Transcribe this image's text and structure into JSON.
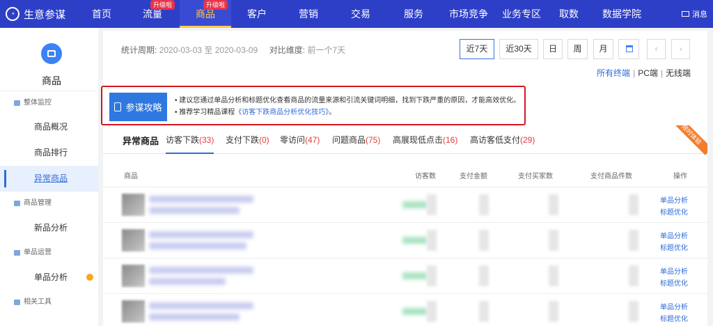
{
  "topnav": {
    "brand": "生意参谋",
    "items": [
      {
        "label": "首页",
        "badge": ""
      },
      {
        "label": "流量",
        "badge": "升级啦"
      },
      {
        "label": "商品",
        "badge": "升级啦"
      },
      {
        "label": "客户",
        "badge": ""
      },
      {
        "label": "营销",
        "badge": ""
      },
      {
        "label": "交易",
        "badge": ""
      },
      {
        "label": "服务",
        "badge": ""
      },
      {
        "label": "市场竞争",
        "badge": ""
      },
      {
        "label": "业务专区",
        "badge": ""
      },
      {
        "label": "取数",
        "badge": ""
      },
      {
        "label": "数据学院",
        "badge": ""
      }
    ],
    "active_index": 2,
    "message": "消息"
  },
  "sidebar": {
    "title": "商品",
    "groups": [
      {
        "label": "整体监控",
        "items": [
          "商品概况",
          "商品排行",
          "异常商品"
        ]
      },
      {
        "label": "商品管理",
        "items": [
          "新品分析"
        ]
      },
      {
        "label": "单品运营",
        "items": [
          "单品分析"
        ]
      },
      {
        "label": "相关工具",
        "items": []
      }
    ],
    "active_item": "异常商品"
  },
  "filter": {
    "period_label": "统计周期:",
    "period_value": "2020-03-03 至 2020-03-09",
    "compare_label": "对比维度:",
    "compare_value": "前一个7天",
    "buttons": [
      "近7天",
      "近30天",
      "日",
      "周",
      "月"
    ],
    "selected_button": "近7天",
    "terminals": [
      "所有终端",
      "PC端",
      "无线端"
    ]
  },
  "hint": {
    "label": "参谋攻略",
    "line1": "• 建议您通过单品分析和标题优化查看商品的流量来源和引流关键词明细，找到下跌严重的原因，才能高效优化。",
    "line2_prefix": "• 推荐学习精品课程",
    "line2_link": "《访客下跌商品分析优化技巧》",
    "line2_suffix": "。"
  },
  "main": {
    "title": "异常商品",
    "tabs": [
      {
        "label": "访客下跌",
        "count": "(33)"
      },
      {
        "label": "支付下跌",
        "count": "(0)"
      },
      {
        "label": "零访问",
        "count": "(47)"
      },
      {
        "label": "问题商品",
        "count": "(75)"
      },
      {
        "label": "高展现低点击",
        "count": "(16)"
      },
      {
        "label": "高访客低支付",
        "count": "(29)"
      }
    ],
    "ribbon": "限时体验",
    "columns": [
      "商品",
      "访客数",
      "支付金额",
      "支付买家数",
      "支付商品件数",
      "操作"
    ],
    "row_actions": [
      "单品分析",
      "标题优化"
    ]
  },
  "colors": {
    "nav_bg": "#2e3fc7",
    "accent": "#2f6bd8",
    "highlight_border": "#d8151f",
    "count_red": "#e23c3c"
  }
}
